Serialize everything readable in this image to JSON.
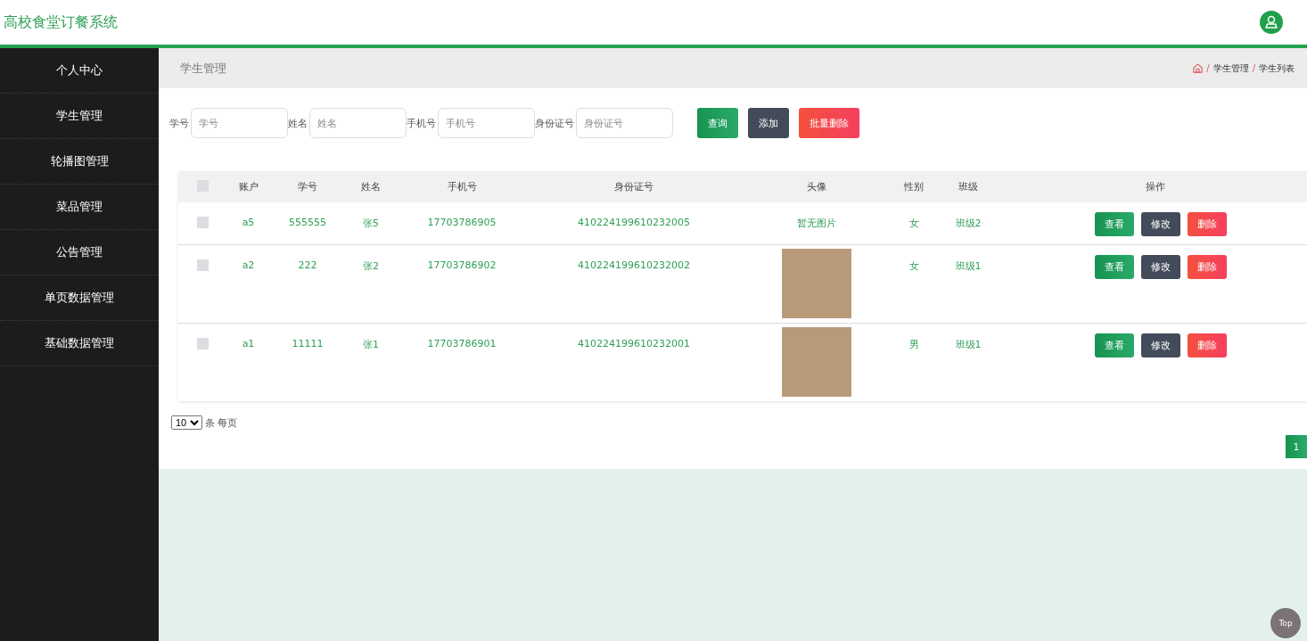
{
  "header": {
    "title": "高校食堂订餐系统"
  },
  "sidebar": {
    "items": [
      {
        "label": "个人中心"
      },
      {
        "label": "学生管理"
      },
      {
        "label": "轮播图管理"
      },
      {
        "label": "菜品管理"
      },
      {
        "label": "公告管理"
      },
      {
        "label": "单页数据管理"
      },
      {
        "label": "基础数据管理"
      }
    ]
  },
  "page_title": "学生管理",
  "breadcrumb": {
    "items": [
      {
        "separator": "/",
        "label": "学生管理"
      },
      {
        "separator": "/",
        "label": "学生列表"
      }
    ]
  },
  "search": {
    "fields": [
      {
        "label": "学号",
        "placeholder": "学号"
      },
      {
        "label": "姓名",
        "placeholder": "姓名"
      },
      {
        "label": "手机号",
        "placeholder": "手机号"
      },
      {
        "label": "身份证号",
        "placeholder": "身份证号"
      }
    ],
    "buttons": [
      {
        "label": "查询",
        "kind": "primary"
      },
      {
        "label": "添加",
        "kind": "dark"
      },
      {
        "label": "批量删除",
        "kind": "danger"
      }
    ]
  },
  "table": {
    "select_all_checked": false,
    "columns": [
      "账户",
      "学号",
      "姓名",
      "手机号",
      "身份证号",
      "头像",
      "性别",
      "班级",
      "操作"
    ],
    "rows": [
      {
        "checked": false,
        "cells": [
          "a5",
          "555555",
          "张5",
          "17703786905",
          "410224199610232005"
        ],
        "avatar": {
          "kind": "text",
          "text": "暂无图片"
        },
        "gender": "女",
        "class": "班级2",
        "actions": [
          {
            "label": "查看",
            "kind": "primary"
          },
          {
            "label": "修改",
            "kind": "dark"
          },
          {
            "label": "删除",
            "kind": "danger"
          }
        ]
      },
      {
        "checked": false,
        "cells": [
          "a2",
          "222",
          "张2",
          "17703786902",
          "410224199610232002"
        ],
        "avatar": {
          "kind": "photo"
        },
        "gender": "女",
        "class": "班级1",
        "actions": [
          {
            "label": "查看",
            "kind": "primary"
          },
          {
            "label": "修改",
            "kind": "dark"
          },
          {
            "label": "删除",
            "kind": "danger"
          }
        ]
      },
      {
        "checked": false,
        "cells": [
          "a1",
          "11111",
          "张1",
          "17703786901",
          "410224199610232001"
        ],
        "avatar": {
          "kind": "photo"
        },
        "gender": "男",
        "class": "班级1",
        "actions": [
          {
            "label": "查看",
            "kind": "primary"
          },
          {
            "label": "修改",
            "kind": "dark"
          },
          {
            "label": "删除",
            "kind": "danger"
          }
        ]
      }
    ]
  },
  "pagination": {
    "page_size": "10",
    "page_size_label": "条 每页",
    "pages": [
      {
        "label": "1",
        "selected": true
      }
    ]
  },
  "top_button": "Top"
}
